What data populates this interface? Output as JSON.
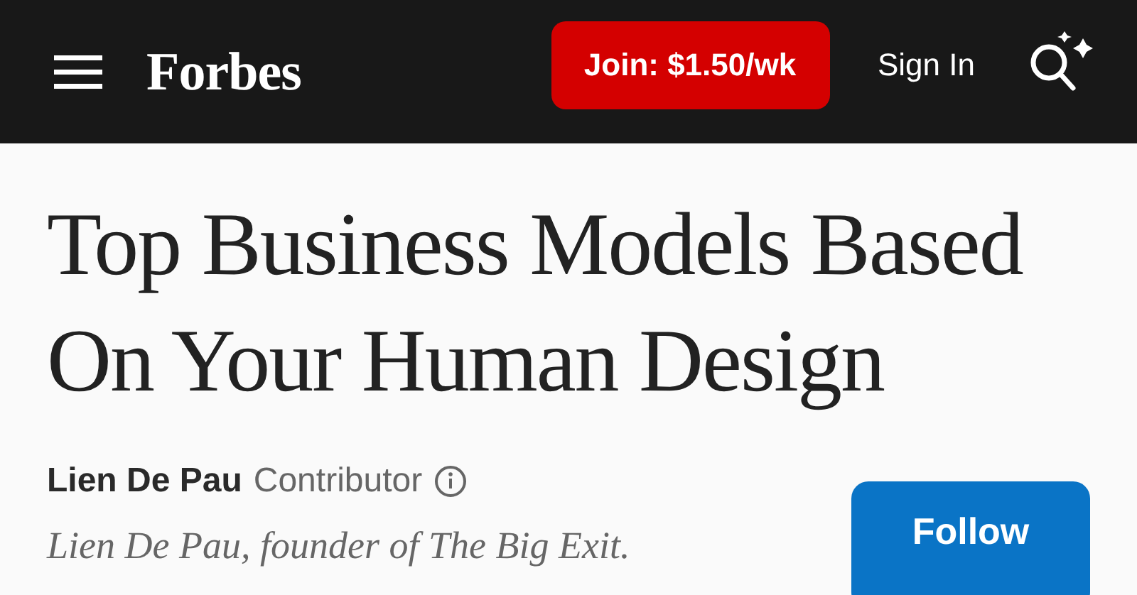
{
  "header": {
    "logo": "Forbes",
    "subscribe_button": "Join: $1.50/wk",
    "sign_in": "Sign In"
  },
  "article": {
    "title": "Top Business Models Based On Your Human Design",
    "author": "Lien De Pau",
    "role": "Contributor",
    "bio": "Lien De Pau, founder of The Big Exit.",
    "follow_button": "Follow"
  }
}
